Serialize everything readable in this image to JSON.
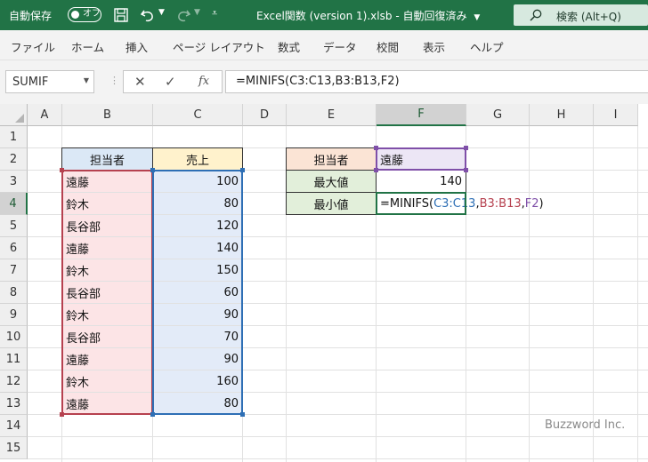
{
  "titlebar": {
    "autosave_label": "自動保存",
    "autosave_state": "オフ",
    "filename": "Excel関数 (version 1).xlsb",
    "save_status": "自動回復済み",
    "search_placeholder": "検索 (Alt+Q)"
  },
  "ribbon": {
    "tabs": [
      "ファイル",
      "ホーム",
      "挿入",
      "ページ レイアウト",
      "数式",
      "データ",
      "校閲",
      "表示",
      "ヘルプ"
    ]
  },
  "formula_bar": {
    "name_box": "SUMIF",
    "formula": "=MINIFS(C3:C13,B3:B13,F2)"
  },
  "grid": {
    "columns": [
      "A",
      "B",
      "C",
      "D",
      "E",
      "F",
      "G",
      "H",
      "I"
    ],
    "rows": [
      "1",
      "2",
      "3",
      "4",
      "5",
      "6",
      "7",
      "8",
      "9",
      "10",
      "11",
      "12",
      "13",
      "14",
      "15"
    ],
    "selected_column": "F",
    "selected_row": "4",
    "table": {
      "header_person": "担当者",
      "header_sales": "売上",
      "persons": [
        "遠藤",
        "鈴木",
        "長谷部",
        "遠藤",
        "鈴木",
        "長谷部",
        "鈴木",
        "長谷部",
        "遠藤",
        "鈴木",
        "遠藤"
      ],
      "sales": [
        "100",
        "80",
        "120",
        "140",
        "150",
        "60",
        "90",
        "70",
        "90",
        "160",
        "80"
      ]
    },
    "lookup": {
      "label_person": "担当者",
      "value_person": "遠藤",
      "label_max": "最大値",
      "value_max": "140",
      "label_min": "最小値",
      "edit_parts": {
        "fn": "=MINIFS(",
        "ref1": "C3:C13",
        "sep1": ",",
        "ref2": "B3:B13",
        "sep2": ",",
        "ref3": "F2",
        "close": ")"
      }
    }
  },
  "colors": {
    "excel_green": "#217346",
    "ref_blue": "#2e6fb5",
    "ref_red": "#b6414f",
    "ref_purple": "#7f4fa8"
  },
  "watermark": "Buzzword Inc."
}
